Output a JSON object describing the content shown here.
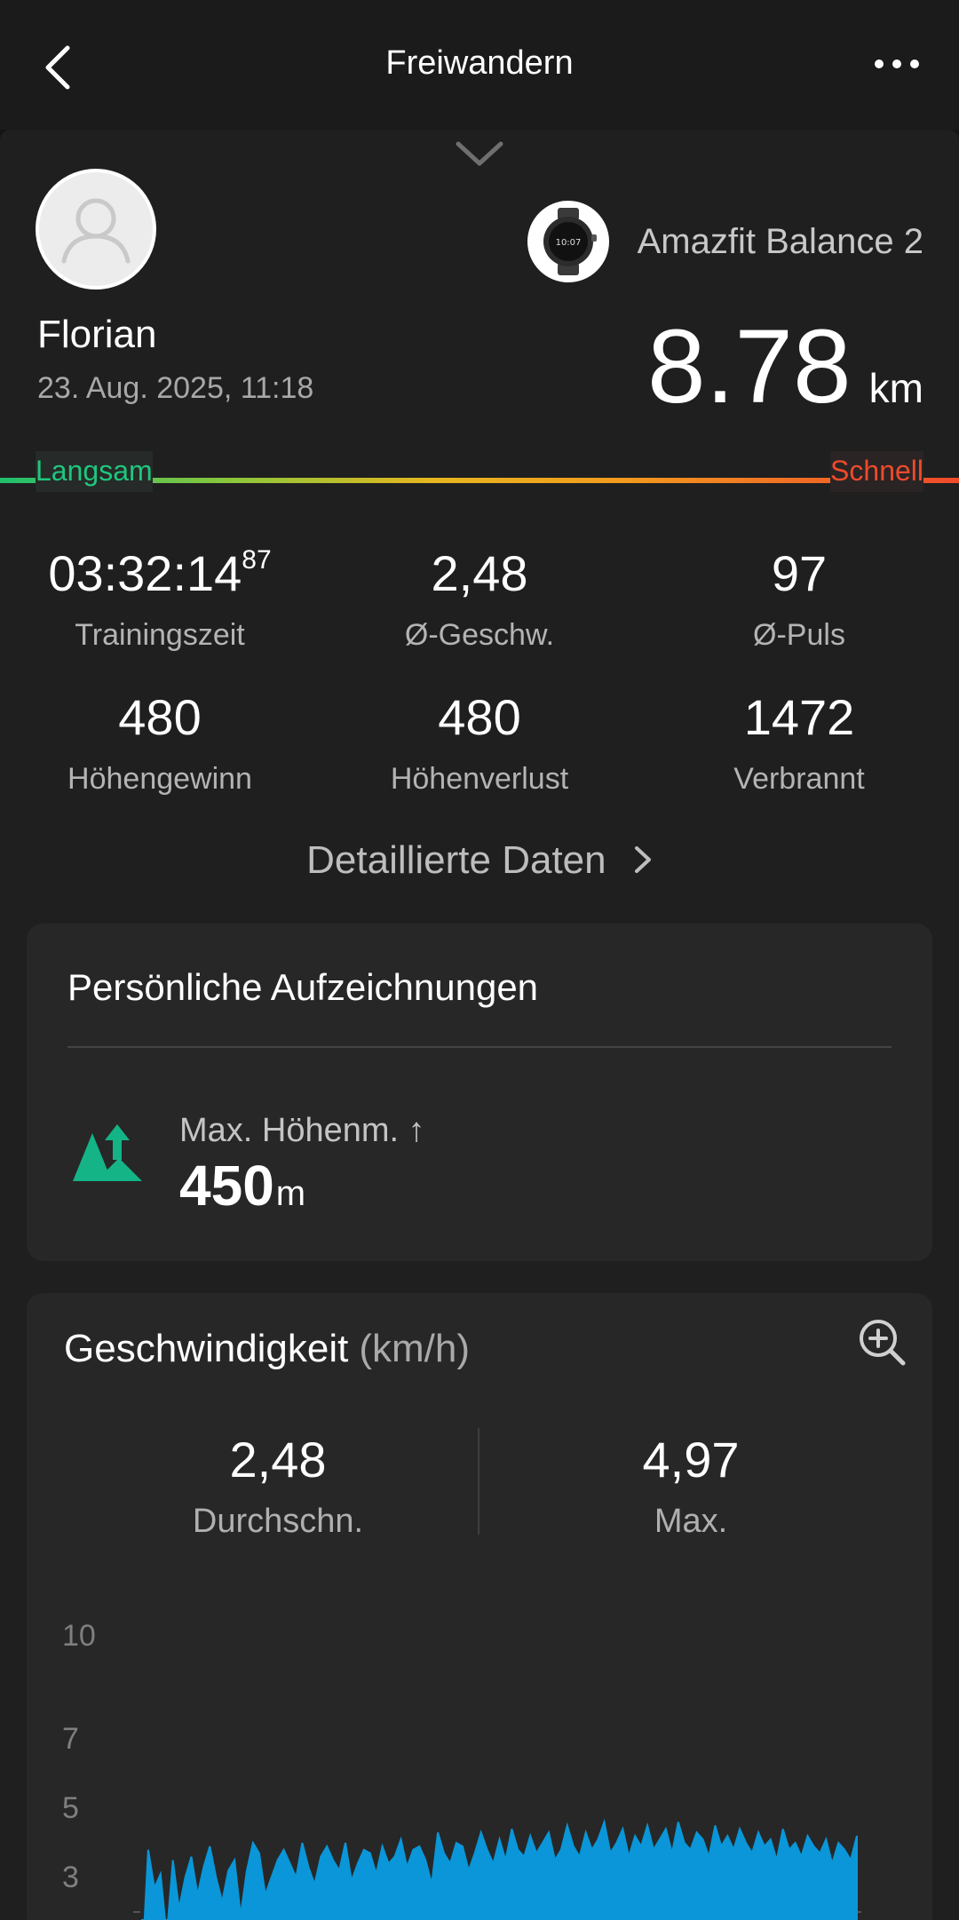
{
  "header": {
    "title": "Freiwandern"
  },
  "profile": {
    "name": "Florian",
    "datetime": "23. Aug. 2025, 11:18",
    "device": "Amazfit Balance 2"
  },
  "summary": {
    "distance": "8.78",
    "distance_unit": "km"
  },
  "pace_scale": {
    "slow": "Langsam",
    "fast": "Schnell"
  },
  "stats": {
    "training_time_main": "03:32:14",
    "training_time_sup": "87",
    "training_time_label": "Trainingszeit",
    "avg_speed": "2,48",
    "avg_speed_label": "Ø-Geschw.",
    "avg_hr": "97",
    "avg_hr_label": "Ø-Puls",
    "elev_gain": "480",
    "elev_gain_label": "Höhengewinn",
    "elev_loss": "480",
    "elev_loss_label": "Höhenverlust",
    "calories": "1472",
    "calories_label": "Verbrannt"
  },
  "detail_link": "Detaillierte Daten",
  "records": {
    "title": "Persönliche Aufzeichnungen",
    "item_label": "Max. Höhenm. ↑",
    "item_value": "450",
    "item_unit": "m"
  },
  "speed": {
    "title": "Geschwindigkeit",
    "unit": "(km/h)",
    "avg": "2,48",
    "avg_label": "Durchschn.",
    "max": "4,97",
    "max_label": "Max."
  },
  "colors": {
    "accent_green": "#1fc67e",
    "accent_red": "#ef4a2c",
    "chart_blue": "#0a96d8",
    "record_green": "#14b487"
  },
  "chart_data": {
    "type": "area",
    "title": "Geschwindigkeit",
    "ylabel": "(km/h)",
    "yticks": [
      "10",
      "7",
      "5",
      "3"
    ],
    "ylim": [
      0,
      10
    ],
    "values": [
      0.5,
      3.9,
      2.8,
      3.2,
      1.4,
      3.6,
      2.2,
      3.1,
      3.7,
      2.6,
      3.4,
      4.0,
      3.1,
      2.4,
      3.3,
      3.6,
      2.0,
      3.3,
      4.1,
      3.8,
      2.6,
      3.1,
      3.6,
      3.9,
      3.5,
      3.1,
      4.1,
      3.4,
      2.9,
      3.7,
      4.0,
      3.6,
      3.3,
      4.1,
      3.0,
      3.5,
      3.9,
      3.8,
      3.2,
      4.0,
      3.5,
      3.7,
      4.2,
      3.4,
      3.9,
      4.0,
      3.6,
      2.9,
      4.4,
      3.8,
      3.5,
      4.1,
      4.0,
      3.3,
      3.8,
      4.4,
      3.9,
      3.5,
      4.2,
      3.6,
      4.5,
      3.9,
      3.7,
      4.3,
      3.8,
      4.1,
      4.4,
      3.6,
      3.9,
      4.6,
      4.0,
      3.7,
      4.4,
      3.9,
      4.2,
      4.7,
      3.8,
      4.1,
      4.5,
      3.7,
      4.3,
      4.0,
      4.6,
      3.9,
      4.2,
      4.5,
      3.8,
      4.7,
      4.1,
      3.9,
      4.4,
      4.2,
      3.7,
      4.6,
      4.0,
      4.3,
      3.9,
      4.5,
      4.1,
      3.8,
      4.4,
      4.0,
      4.2,
      3.6,
      4.5,
      3.9,
      4.1,
      3.7,
      4.3,
      4.0,
      3.8,
      4.2,
      3.5,
      4.1,
      3.9,
      3.6,
      4.3
    ]
  }
}
